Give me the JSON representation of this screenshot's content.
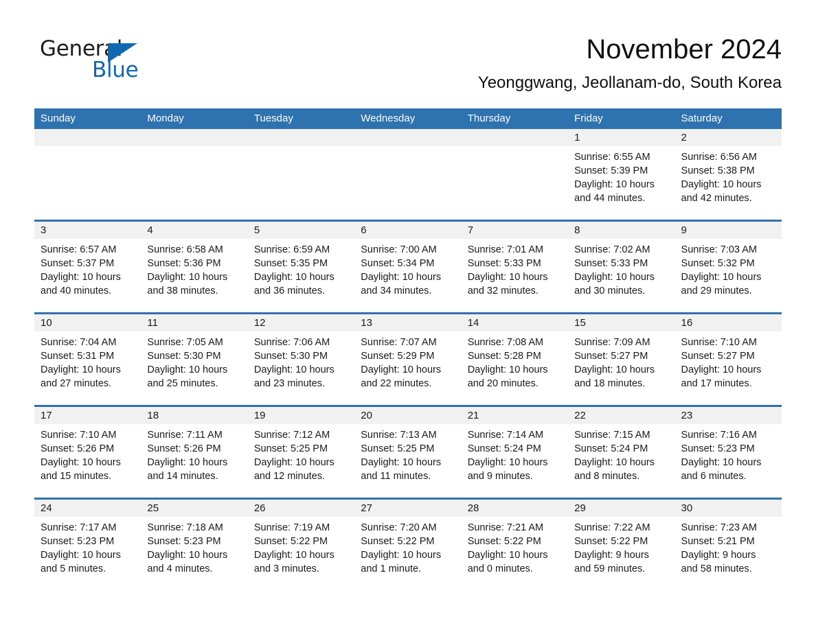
{
  "brand": {
    "name_part1": "General",
    "name_part2": "Blue",
    "triangle_icon": "triangle-icon",
    "accent_color": "#1068b3"
  },
  "header": {
    "title": "November 2024",
    "subtitle": "Yeonggwang, Jeollanam-do, South Korea"
  },
  "calendar": {
    "header_bg": "#2e72b0",
    "daynum_bg": "#f1f1f1",
    "weekdays": [
      "Sunday",
      "Monday",
      "Tuesday",
      "Wednesday",
      "Thursday",
      "Friday",
      "Saturday"
    ],
    "weeks": [
      [
        {
          "day": "",
          "sunrise": "",
          "sunset": "",
          "daylight1": "",
          "daylight2": ""
        },
        {
          "day": "",
          "sunrise": "",
          "sunset": "",
          "daylight1": "",
          "daylight2": ""
        },
        {
          "day": "",
          "sunrise": "",
          "sunset": "",
          "daylight1": "",
          "daylight2": ""
        },
        {
          "day": "",
          "sunrise": "",
          "sunset": "",
          "daylight1": "",
          "daylight2": ""
        },
        {
          "day": "",
          "sunrise": "",
          "sunset": "",
          "daylight1": "",
          "daylight2": ""
        },
        {
          "day": "1",
          "sunrise": "Sunrise: 6:55 AM",
          "sunset": "Sunset: 5:39 PM",
          "daylight1": "Daylight: 10 hours",
          "daylight2": "and 44 minutes."
        },
        {
          "day": "2",
          "sunrise": "Sunrise: 6:56 AM",
          "sunset": "Sunset: 5:38 PM",
          "daylight1": "Daylight: 10 hours",
          "daylight2": "and 42 minutes."
        }
      ],
      [
        {
          "day": "3",
          "sunrise": "Sunrise: 6:57 AM",
          "sunset": "Sunset: 5:37 PM",
          "daylight1": "Daylight: 10 hours",
          "daylight2": "and 40 minutes."
        },
        {
          "day": "4",
          "sunrise": "Sunrise: 6:58 AM",
          "sunset": "Sunset: 5:36 PM",
          "daylight1": "Daylight: 10 hours",
          "daylight2": "and 38 minutes."
        },
        {
          "day": "5",
          "sunrise": "Sunrise: 6:59 AM",
          "sunset": "Sunset: 5:35 PM",
          "daylight1": "Daylight: 10 hours",
          "daylight2": "and 36 minutes."
        },
        {
          "day": "6",
          "sunrise": "Sunrise: 7:00 AM",
          "sunset": "Sunset: 5:34 PM",
          "daylight1": "Daylight: 10 hours",
          "daylight2": "and 34 minutes."
        },
        {
          "day": "7",
          "sunrise": "Sunrise: 7:01 AM",
          "sunset": "Sunset: 5:33 PM",
          "daylight1": "Daylight: 10 hours",
          "daylight2": "and 32 minutes."
        },
        {
          "day": "8",
          "sunrise": "Sunrise: 7:02 AM",
          "sunset": "Sunset: 5:33 PM",
          "daylight1": "Daylight: 10 hours",
          "daylight2": "and 30 minutes."
        },
        {
          "day": "9",
          "sunrise": "Sunrise: 7:03 AM",
          "sunset": "Sunset: 5:32 PM",
          "daylight1": "Daylight: 10 hours",
          "daylight2": "and 29 minutes."
        }
      ],
      [
        {
          "day": "10",
          "sunrise": "Sunrise: 7:04 AM",
          "sunset": "Sunset: 5:31 PM",
          "daylight1": "Daylight: 10 hours",
          "daylight2": "and 27 minutes."
        },
        {
          "day": "11",
          "sunrise": "Sunrise: 7:05 AM",
          "sunset": "Sunset: 5:30 PM",
          "daylight1": "Daylight: 10 hours",
          "daylight2": "and 25 minutes."
        },
        {
          "day": "12",
          "sunrise": "Sunrise: 7:06 AM",
          "sunset": "Sunset: 5:30 PM",
          "daylight1": "Daylight: 10 hours",
          "daylight2": "and 23 minutes."
        },
        {
          "day": "13",
          "sunrise": "Sunrise: 7:07 AM",
          "sunset": "Sunset: 5:29 PM",
          "daylight1": "Daylight: 10 hours",
          "daylight2": "and 22 minutes."
        },
        {
          "day": "14",
          "sunrise": "Sunrise: 7:08 AM",
          "sunset": "Sunset: 5:28 PM",
          "daylight1": "Daylight: 10 hours",
          "daylight2": "and 20 minutes."
        },
        {
          "day": "15",
          "sunrise": "Sunrise: 7:09 AM",
          "sunset": "Sunset: 5:27 PM",
          "daylight1": "Daylight: 10 hours",
          "daylight2": "and 18 minutes."
        },
        {
          "day": "16",
          "sunrise": "Sunrise: 7:10 AM",
          "sunset": "Sunset: 5:27 PM",
          "daylight1": "Daylight: 10 hours",
          "daylight2": "and 17 minutes."
        }
      ],
      [
        {
          "day": "17",
          "sunrise": "Sunrise: 7:10 AM",
          "sunset": "Sunset: 5:26 PM",
          "daylight1": "Daylight: 10 hours",
          "daylight2": "and 15 minutes."
        },
        {
          "day": "18",
          "sunrise": "Sunrise: 7:11 AM",
          "sunset": "Sunset: 5:26 PM",
          "daylight1": "Daylight: 10 hours",
          "daylight2": "and 14 minutes."
        },
        {
          "day": "19",
          "sunrise": "Sunrise: 7:12 AM",
          "sunset": "Sunset: 5:25 PM",
          "daylight1": "Daylight: 10 hours",
          "daylight2": "and 12 minutes."
        },
        {
          "day": "20",
          "sunrise": "Sunrise: 7:13 AM",
          "sunset": "Sunset: 5:25 PM",
          "daylight1": "Daylight: 10 hours",
          "daylight2": "and 11 minutes."
        },
        {
          "day": "21",
          "sunrise": "Sunrise: 7:14 AM",
          "sunset": "Sunset: 5:24 PM",
          "daylight1": "Daylight: 10 hours",
          "daylight2": "and 9 minutes."
        },
        {
          "day": "22",
          "sunrise": "Sunrise: 7:15 AM",
          "sunset": "Sunset: 5:24 PM",
          "daylight1": "Daylight: 10 hours",
          "daylight2": "and 8 minutes."
        },
        {
          "day": "23",
          "sunrise": "Sunrise: 7:16 AM",
          "sunset": "Sunset: 5:23 PM",
          "daylight1": "Daylight: 10 hours",
          "daylight2": "and 6 minutes."
        }
      ],
      [
        {
          "day": "24",
          "sunrise": "Sunrise: 7:17 AM",
          "sunset": "Sunset: 5:23 PM",
          "daylight1": "Daylight: 10 hours",
          "daylight2": "and 5 minutes."
        },
        {
          "day": "25",
          "sunrise": "Sunrise: 7:18 AM",
          "sunset": "Sunset: 5:23 PM",
          "daylight1": "Daylight: 10 hours",
          "daylight2": "and 4 minutes."
        },
        {
          "day": "26",
          "sunrise": "Sunrise: 7:19 AM",
          "sunset": "Sunset: 5:22 PM",
          "daylight1": "Daylight: 10 hours",
          "daylight2": "and 3 minutes."
        },
        {
          "day": "27",
          "sunrise": "Sunrise: 7:20 AM",
          "sunset": "Sunset: 5:22 PM",
          "daylight1": "Daylight: 10 hours",
          "daylight2": "and 1 minute."
        },
        {
          "day": "28",
          "sunrise": "Sunrise: 7:21 AM",
          "sunset": "Sunset: 5:22 PM",
          "daylight1": "Daylight: 10 hours",
          "daylight2": "and 0 minutes."
        },
        {
          "day": "29",
          "sunrise": "Sunrise: 7:22 AM",
          "sunset": "Sunset: 5:22 PM",
          "daylight1": "Daylight: 9 hours",
          "daylight2": "and 59 minutes."
        },
        {
          "day": "30",
          "sunrise": "Sunrise: 7:23 AM",
          "sunset": "Sunset: 5:21 PM",
          "daylight1": "Daylight: 9 hours",
          "daylight2": "and 58 minutes."
        }
      ]
    ]
  }
}
